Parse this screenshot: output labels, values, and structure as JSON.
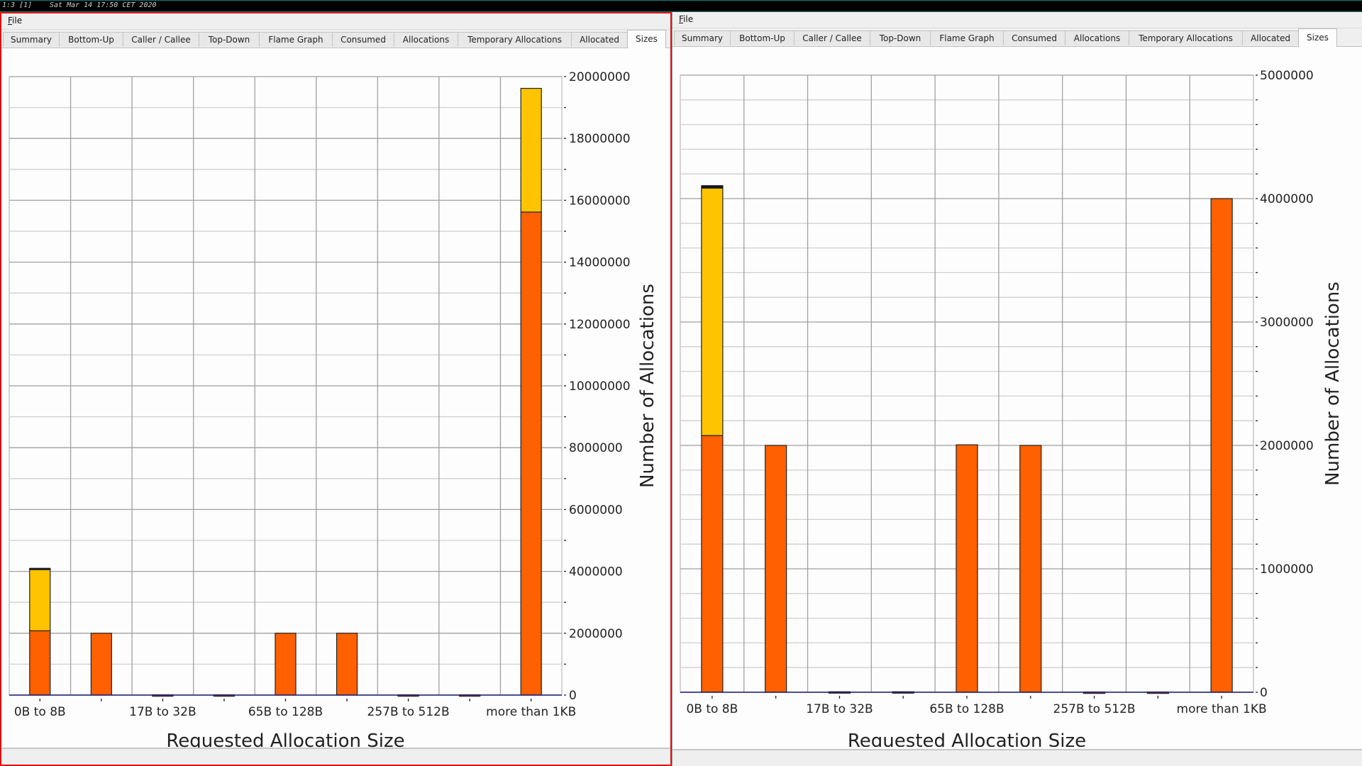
{
  "topbar": {
    "workspace": "1:3 [1]",
    "clock": "Sat Mar 14 17:50 CET 2020"
  },
  "panes": [
    {
      "menu": {
        "file": "File"
      },
      "tabs": [
        "Summary",
        "Bottom-Up",
        "Caller / Callee",
        "Top-Down",
        "Flame Graph",
        "Consumed",
        "Allocations",
        "Temporary Allocations",
        "Allocated",
        "Sizes"
      ],
      "active_tab": "Sizes"
    },
    {
      "menu": {
        "file": "File"
      },
      "tabs": [
        "Summary",
        "Bottom-Up",
        "Caller / Callee",
        "Top-Down",
        "Flame Graph",
        "Consumed",
        "Allocations",
        "Temporary Allocations",
        "Allocated",
        "Sizes"
      ],
      "active_tab": "Sizes"
    }
  ],
  "colors": {
    "series_bottom": "#ff6000",
    "series_middle": "#ffc400",
    "series_top": "#111111",
    "grid": "#aaaaaa",
    "axis": "#1a1a7a",
    "pane_focus_border": "#e01010"
  },
  "chart_data": [
    {
      "type": "bar",
      "stacked": true,
      "xlabel": "Requested Allocation Size",
      "ylabel": "Number of Allocations",
      "categories": [
        "0B to 8B",
        "",
        "17B to 32B",
        "",
        "65B to 128B",
        "",
        "257B to 512B",
        "",
        "more than 1KB"
      ],
      "ylim": [
        0,
        20000000
      ],
      "yticks": [
        0,
        2000000,
        4000000,
        6000000,
        8000000,
        10000000,
        12000000,
        14000000,
        16000000,
        18000000,
        20000000
      ],
      "ytick_labels": [
        "0",
        "2000000",
        "4000000",
        "6000000",
        "8000000",
        "10000000",
        "12000000",
        "14000000",
        "16000000",
        "18000000",
        "20000000"
      ],
      "y_minor_step": 1000000,
      "grid": true,
      "y_axis_side": "right",
      "series": [
        {
          "values": [
            2080000,
            2000000,
            8000,
            8000,
            2000000,
            2000000,
            8000,
            8000,
            15620000
          ],
          "color": "#ff6000"
        },
        {
          "values": [
            2000000,
            0,
            0,
            0,
            0,
            0,
            0,
            0,
            4000000
          ],
          "color": "#ffc400"
        },
        {
          "values": [
            20000,
            0,
            0,
            0,
            0,
            0,
            0,
            0,
            0
          ],
          "color": "#111111"
        }
      ]
    },
    {
      "type": "bar",
      "stacked": true,
      "xlabel": "Requested Allocation Size",
      "ylabel": "Number of Allocations",
      "categories": [
        "0B to 8B",
        "",
        "17B to 32B",
        "",
        "65B to 128B",
        "",
        "257B to 512B",
        "",
        "more than 1KB"
      ],
      "ylim": [
        0,
        5000000
      ],
      "yticks": [
        0,
        1000000,
        2000000,
        3000000,
        4000000,
        5000000
      ],
      "ytick_labels": [
        "0",
        "1000000",
        "2000000",
        "3000000",
        "4000000",
        "5000000"
      ],
      "y_minor_step": 200000,
      "grid": true,
      "y_axis_side": "right",
      "series": [
        {
          "values": [
            2080000,
            2000000,
            4000,
            4000,
            2005000,
            2000000,
            2000,
            2000,
            4000000
          ],
          "color": "#ff6000"
        },
        {
          "values": [
            2005000,
            0,
            0,
            0,
            0,
            0,
            0,
            0,
            0
          ],
          "color": "#ffc400"
        },
        {
          "values": [
            20000,
            0,
            0,
            0,
            0,
            0,
            0,
            0,
            0
          ],
          "color": "#111111"
        }
      ]
    }
  ]
}
